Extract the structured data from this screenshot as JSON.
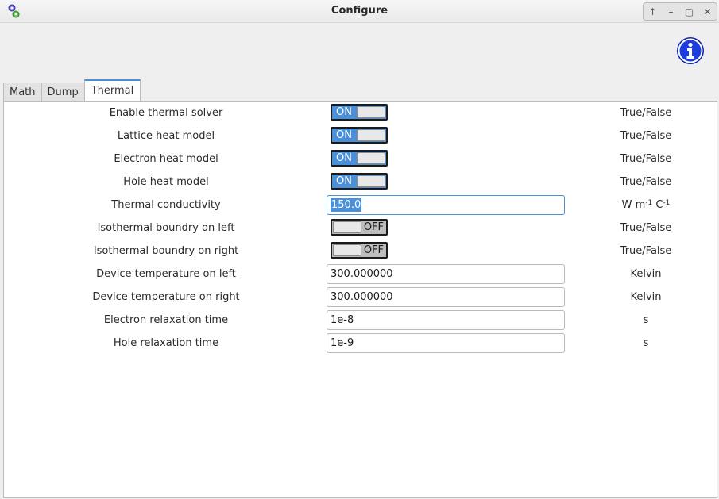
{
  "window": {
    "title": "Configure",
    "accent": "#4a90d9"
  },
  "tabs": [
    {
      "label": "Math"
    },
    {
      "label": "Dump"
    },
    {
      "label": "Thermal",
      "active": true
    }
  ],
  "rows": [
    {
      "label": "Enable thermal solver",
      "type": "switch",
      "value": "ON",
      "unit": "True/False"
    },
    {
      "label": "Lattice heat model",
      "type": "switch",
      "value": "ON",
      "unit": "True/False"
    },
    {
      "label": "Electron heat model",
      "type": "switch",
      "value": "ON",
      "unit": "True/False"
    },
    {
      "label": "Hole heat model",
      "type": "switch",
      "value": "ON",
      "unit": "True/False"
    },
    {
      "label": "Thermal conductivity",
      "type": "text",
      "value": "150.0",
      "unit_parts": [
        "W m",
        "-1",
        " C",
        "-1"
      ]
    },
    {
      "label": "Isothermal boundry on left",
      "type": "switch",
      "value": "OFF",
      "unit": "True/False"
    },
    {
      "label": "Isothermal boundry on right",
      "type": "switch",
      "value": "OFF",
      "unit": "True/False"
    },
    {
      "label": "Device temperature on left",
      "type": "text",
      "value": "300.000000",
      "unit": "Kelvin"
    },
    {
      "label": "Device temperature on right",
      "type": "text",
      "value": "300.000000",
      "unit": "Kelvin"
    },
    {
      "label": "Electron relaxation time",
      "type": "text",
      "value": "1e-8",
      "unit": "s"
    },
    {
      "label": "Hole relaxation time",
      "type": "text",
      "value": "1e-9",
      "unit": "s"
    }
  ]
}
